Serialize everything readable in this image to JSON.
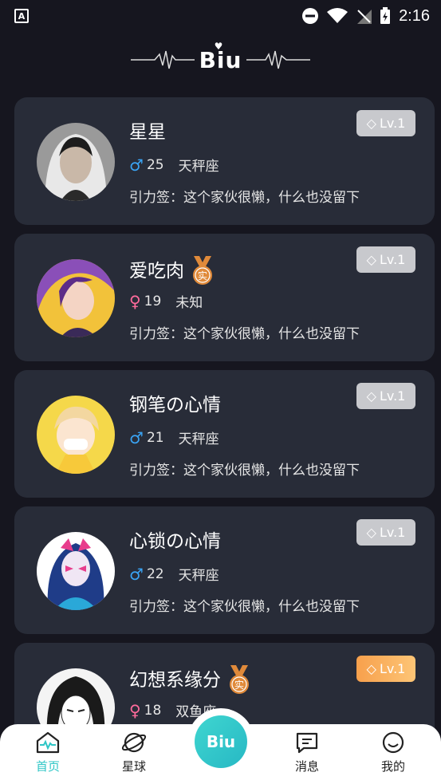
{
  "status_bar": {
    "time": "2:16",
    "notification_icon": "a-icon"
  },
  "header": {
    "logo": "Biu"
  },
  "cards": [
    {
      "name": "星星",
      "gender": "male",
      "gender_symbol": "♂",
      "age": "25",
      "sign": "天秤座",
      "tagline": "引力签：这个家伙很懒，什么也没留下",
      "level": "Lv.1",
      "level_style": "gray",
      "verified": false
    },
    {
      "name": "爱吃肉",
      "gender": "female",
      "gender_symbol": "♀",
      "age": "19",
      "sign": "未知",
      "tagline": "引力签：这个家伙很懒，什么也没留下",
      "level": "Lv.1",
      "level_style": "gray",
      "verified": true,
      "verified_label": "实"
    },
    {
      "name": "钢笔の心情",
      "gender": "male",
      "gender_symbol": "♂",
      "age": "21",
      "sign": "天秤座",
      "tagline": "引力签：这个家伙很懒，什么也没留下",
      "level": "Lv.1",
      "level_style": "gray",
      "verified": false
    },
    {
      "name": "心锁の心情",
      "gender": "male",
      "gender_symbol": "♂",
      "age": "22",
      "sign": "天秤座",
      "tagline": "引力签：这个家伙很懒，什么也没留下",
      "level": "Lv.1",
      "level_style": "gray",
      "verified": false
    },
    {
      "name": "幻想系缘分",
      "gender": "female",
      "gender_symbol": "♀",
      "age": "18",
      "sign": "双鱼座",
      "tagline": "",
      "level": "Lv.1",
      "level_style": "gold",
      "verified": true,
      "verified_label": "实"
    }
  ],
  "bottom_nav": {
    "home": "首页",
    "planet": "星球",
    "center": "Biu",
    "messages": "消息",
    "mine": "我的"
  },
  "colors": {
    "accent": "#2ec6c6",
    "male": "#3aa4f4",
    "female": "#ff6b9c",
    "card_bg": "#282c38",
    "page_bg": "#16161f"
  }
}
